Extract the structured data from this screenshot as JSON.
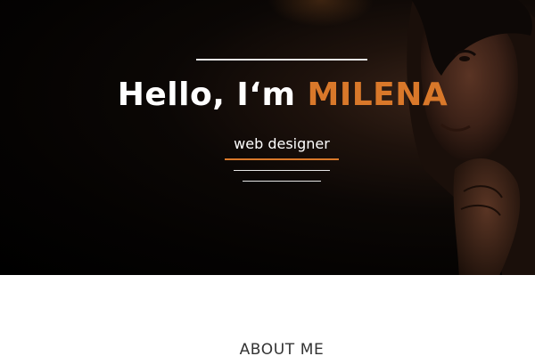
{
  "hero": {
    "greeting": "Hello, I‘m ",
    "name": "MILENA",
    "subtitle": "web designer"
  },
  "about": {
    "heading": "ABOUT ME"
  },
  "colors": {
    "accent": "#d9782a",
    "hero_background": "#000000",
    "page_background": "#ffffff"
  }
}
